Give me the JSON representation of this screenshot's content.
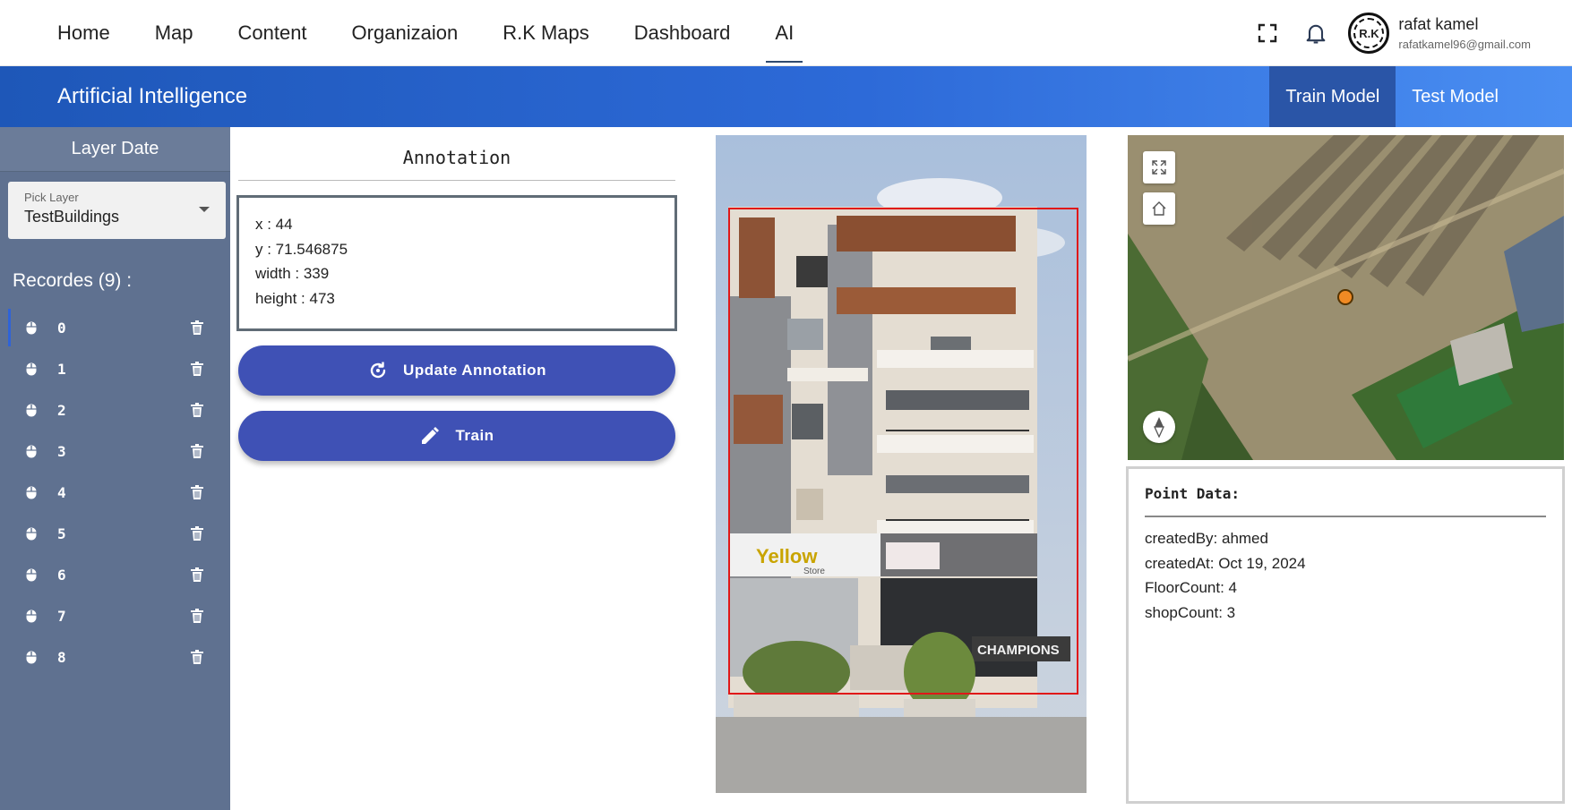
{
  "nav": {
    "items": [
      {
        "label": "Home"
      },
      {
        "label": "Map"
      },
      {
        "label": "Content"
      },
      {
        "label": "Organizaion"
      },
      {
        "label": "R.K Maps"
      },
      {
        "label": "Dashboard"
      },
      {
        "label": "AI",
        "active": true
      }
    ]
  },
  "user": {
    "name": "rafat kamel",
    "email": "rafatkamel96@gmail.com",
    "avatar_text": "R.K"
  },
  "header": {
    "title": "Artificial Intelligence",
    "tabs": [
      {
        "label": "Train Model",
        "active": true
      },
      {
        "label": "Test Model",
        "active": false
      }
    ]
  },
  "sidebar": {
    "title": "Layer Date",
    "select": {
      "label": "Pick Layer",
      "value": "TestBuildings"
    },
    "records_title": "Recordes (9) :",
    "records": [
      {
        "label": "0",
        "active": true
      },
      {
        "label": "1"
      },
      {
        "label": "2"
      },
      {
        "label": "3"
      },
      {
        "label": "4"
      },
      {
        "label": "5"
      },
      {
        "label": "6"
      },
      {
        "label": "7"
      },
      {
        "label": "8"
      }
    ]
  },
  "annotation": {
    "title": "Annotation",
    "lines": [
      "x : 44",
      "y : 71.546875",
      "width : 339",
      "height : 473"
    ],
    "update_button": "Update Annotation",
    "train_button": "Train"
  },
  "photo": {
    "signs": {
      "yellow": "Yellow",
      "yellow_sub": "Store",
      "champions": "CHAMPIONS"
    }
  },
  "point_data": {
    "title": "Point Data:",
    "lines": [
      "createdBy: ahmed",
      "createdAt: Oct 19, 2024",
      "FloorCount: 4",
      "shopCount: 3"
    ]
  },
  "colors": {
    "accent": "#3f51b5",
    "header_gradient_start": "#1e57b8",
    "header_gradient_end": "#4a8ef2",
    "sidebar": "#5f7190",
    "bbox": "#e01818",
    "map_point": "#f08a24"
  }
}
